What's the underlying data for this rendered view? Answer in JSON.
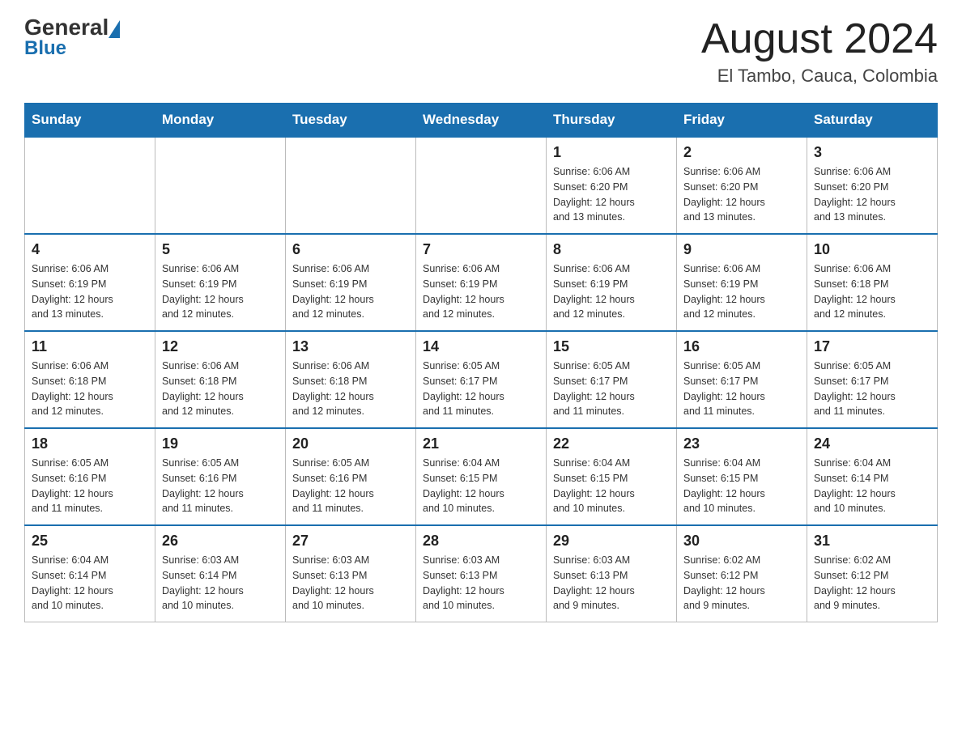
{
  "header": {
    "logo_text_general": "General",
    "logo_text_blue": "Blue",
    "month_title": "August 2024",
    "location": "El Tambo, Cauca, Colombia"
  },
  "days_of_week": [
    "Sunday",
    "Monday",
    "Tuesday",
    "Wednesday",
    "Thursday",
    "Friday",
    "Saturday"
  ],
  "weeks": [
    [
      {
        "day": "",
        "info": ""
      },
      {
        "day": "",
        "info": ""
      },
      {
        "day": "",
        "info": ""
      },
      {
        "day": "",
        "info": ""
      },
      {
        "day": "1",
        "info": "Sunrise: 6:06 AM\nSunset: 6:20 PM\nDaylight: 12 hours\nand 13 minutes."
      },
      {
        "day": "2",
        "info": "Sunrise: 6:06 AM\nSunset: 6:20 PM\nDaylight: 12 hours\nand 13 minutes."
      },
      {
        "day": "3",
        "info": "Sunrise: 6:06 AM\nSunset: 6:20 PM\nDaylight: 12 hours\nand 13 minutes."
      }
    ],
    [
      {
        "day": "4",
        "info": "Sunrise: 6:06 AM\nSunset: 6:19 PM\nDaylight: 12 hours\nand 13 minutes."
      },
      {
        "day": "5",
        "info": "Sunrise: 6:06 AM\nSunset: 6:19 PM\nDaylight: 12 hours\nand 12 minutes."
      },
      {
        "day": "6",
        "info": "Sunrise: 6:06 AM\nSunset: 6:19 PM\nDaylight: 12 hours\nand 12 minutes."
      },
      {
        "day": "7",
        "info": "Sunrise: 6:06 AM\nSunset: 6:19 PM\nDaylight: 12 hours\nand 12 minutes."
      },
      {
        "day": "8",
        "info": "Sunrise: 6:06 AM\nSunset: 6:19 PM\nDaylight: 12 hours\nand 12 minutes."
      },
      {
        "day": "9",
        "info": "Sunrise: 6:06 AM\nSunset: 6:19 PM\nDaylight: 12 hours\nand 12 minutes."
      },
      {
        "day": "10",
        "info": "Sunrise: 6:06 AM\nSunset: 6:18 PM\nDaylight: 12 hours\nand 12 minutes."
      }
    ],
    [
      {
        "day": "11",
        "info": "Sunrise: 6:06 AM\nSunset: 6:18 PM\nDaylight: 12 hours\nand 12 minutes."
      },
      {
        "day": "12",
        "info": "Sunrise: 6:06 AM\nSunset: 6:18 PM\nDaylight: 12 hours\nand 12 minutes."
      },
      {
        "day": "13",
        "info": "Sunrise: 6:06 AM\nSunset: 6:18 PM\nDaylight: 12 hours\nand 12 minutes."
      },
      {
        "day": "14",
        "info": "Sunrise: 6:05 AM\nSunset: 6:17 PM\nDaylight: 12 hours\nand 11 minutes."
      },
      {
        "day": "15",
        "info": "Sunrise: 6:05 AM\nSunset: 6:17 PM\nDaylight: 12 hours\nand 11 minutes."
      },
      {
        "day": "16",
        "info": "Sunrise: 6:05 AM\nSunset: 6:17 PM\nDaylight: 12 hours\nand 11 minutes."
      },
      {
        "day": "17",
        "info": "Sunrise: 6:05 AM\nSunset: 6:17 PM\nDaylight: 12 hours\nand 11 minutes."
      }
    ],
    [
      {
        "day": "18",
        "info": "Sunrise: 6:05 AM\nSunset: 6:16 PM\nDaylight: 12 hours\nand 11 minutes."
      },
      {
        "day": "19",
        "info": "Sunrise: 6:05 AM\nSunset: 6:16 PM\nDaylight: 12 hours\nand 11 minutes."
      },
      {
        "day": "20",
        "info": "Sunrise: 6:05 AM\nSunset: 6:16 PM\nDaylight: 12 hours\nand 11 minutes."
      },
      {
        "day": "21",
        "info": "Sunrise: 6:04 AM\nSunset: 6:15 PM\nDaylight: 12 hours\nand 10 minutes."
      },
      {
        "day": "22",
        "info": "Sunrise: 6:04 AM\nSunset: 6:15 PM\nDaylight: 12 hours\nand 10 minutes."
      },
      {
        "day": "23",
        "info": "Sunrise: 6:04 AM\nSunset: 6:15 PM\nDaylight: 12 hours\nand 10 minutes."
      },
      {
        "day": "24",
        "info": "Sunrise: 6:04 AM\nSunset: 6:14 PM\nDaylight: 12 hours\nand 10 minutes."
      }
    ],
    [
      {
        "day": "25",
        "info": "Sunrise: 6:04 AM\nSunset: 6:14 PM\nDaylight: 12 hours\nand 10 minutes."
      },
      {
        "day": "26",
        "info": "Sunrise: 6:03 AM\nSunset: 6:14 PM\nDaylight: 12 hours\nand 10 minutes."
      },
      {
        "day": "27",
        "info": "Sunrise: 6:03 AM\nSunset: 6:13 PM\nDaylight: 12 hours\nand 10 minutes."
      },
      {
        "day": "28",
        "info": "Sunrise: 6:03 AM\nSunset: 6:13 PM\nDaylight: 12 hours\nand 10 minutes."
      },
      {
        "day": "29",
        "info": "Sunrise: 6:03 AM\nSunset: 6:13 PM\nDaylight: 12 hours\nand 9 minutes."
      },
      {
        "day": "30",
        "info": "Sunrise: 6:02 AM\nSunset: 6:12 PM\nDaylight: 12 hours\nand 9 minutes."
      },
      {
        "day": "31",
        "info": "Sunrise: 6:02 AM\nSunset: 6:12 PM\nDaylight: 12 hours\nand 9 minutes."
      }
    ]
  ]
}
